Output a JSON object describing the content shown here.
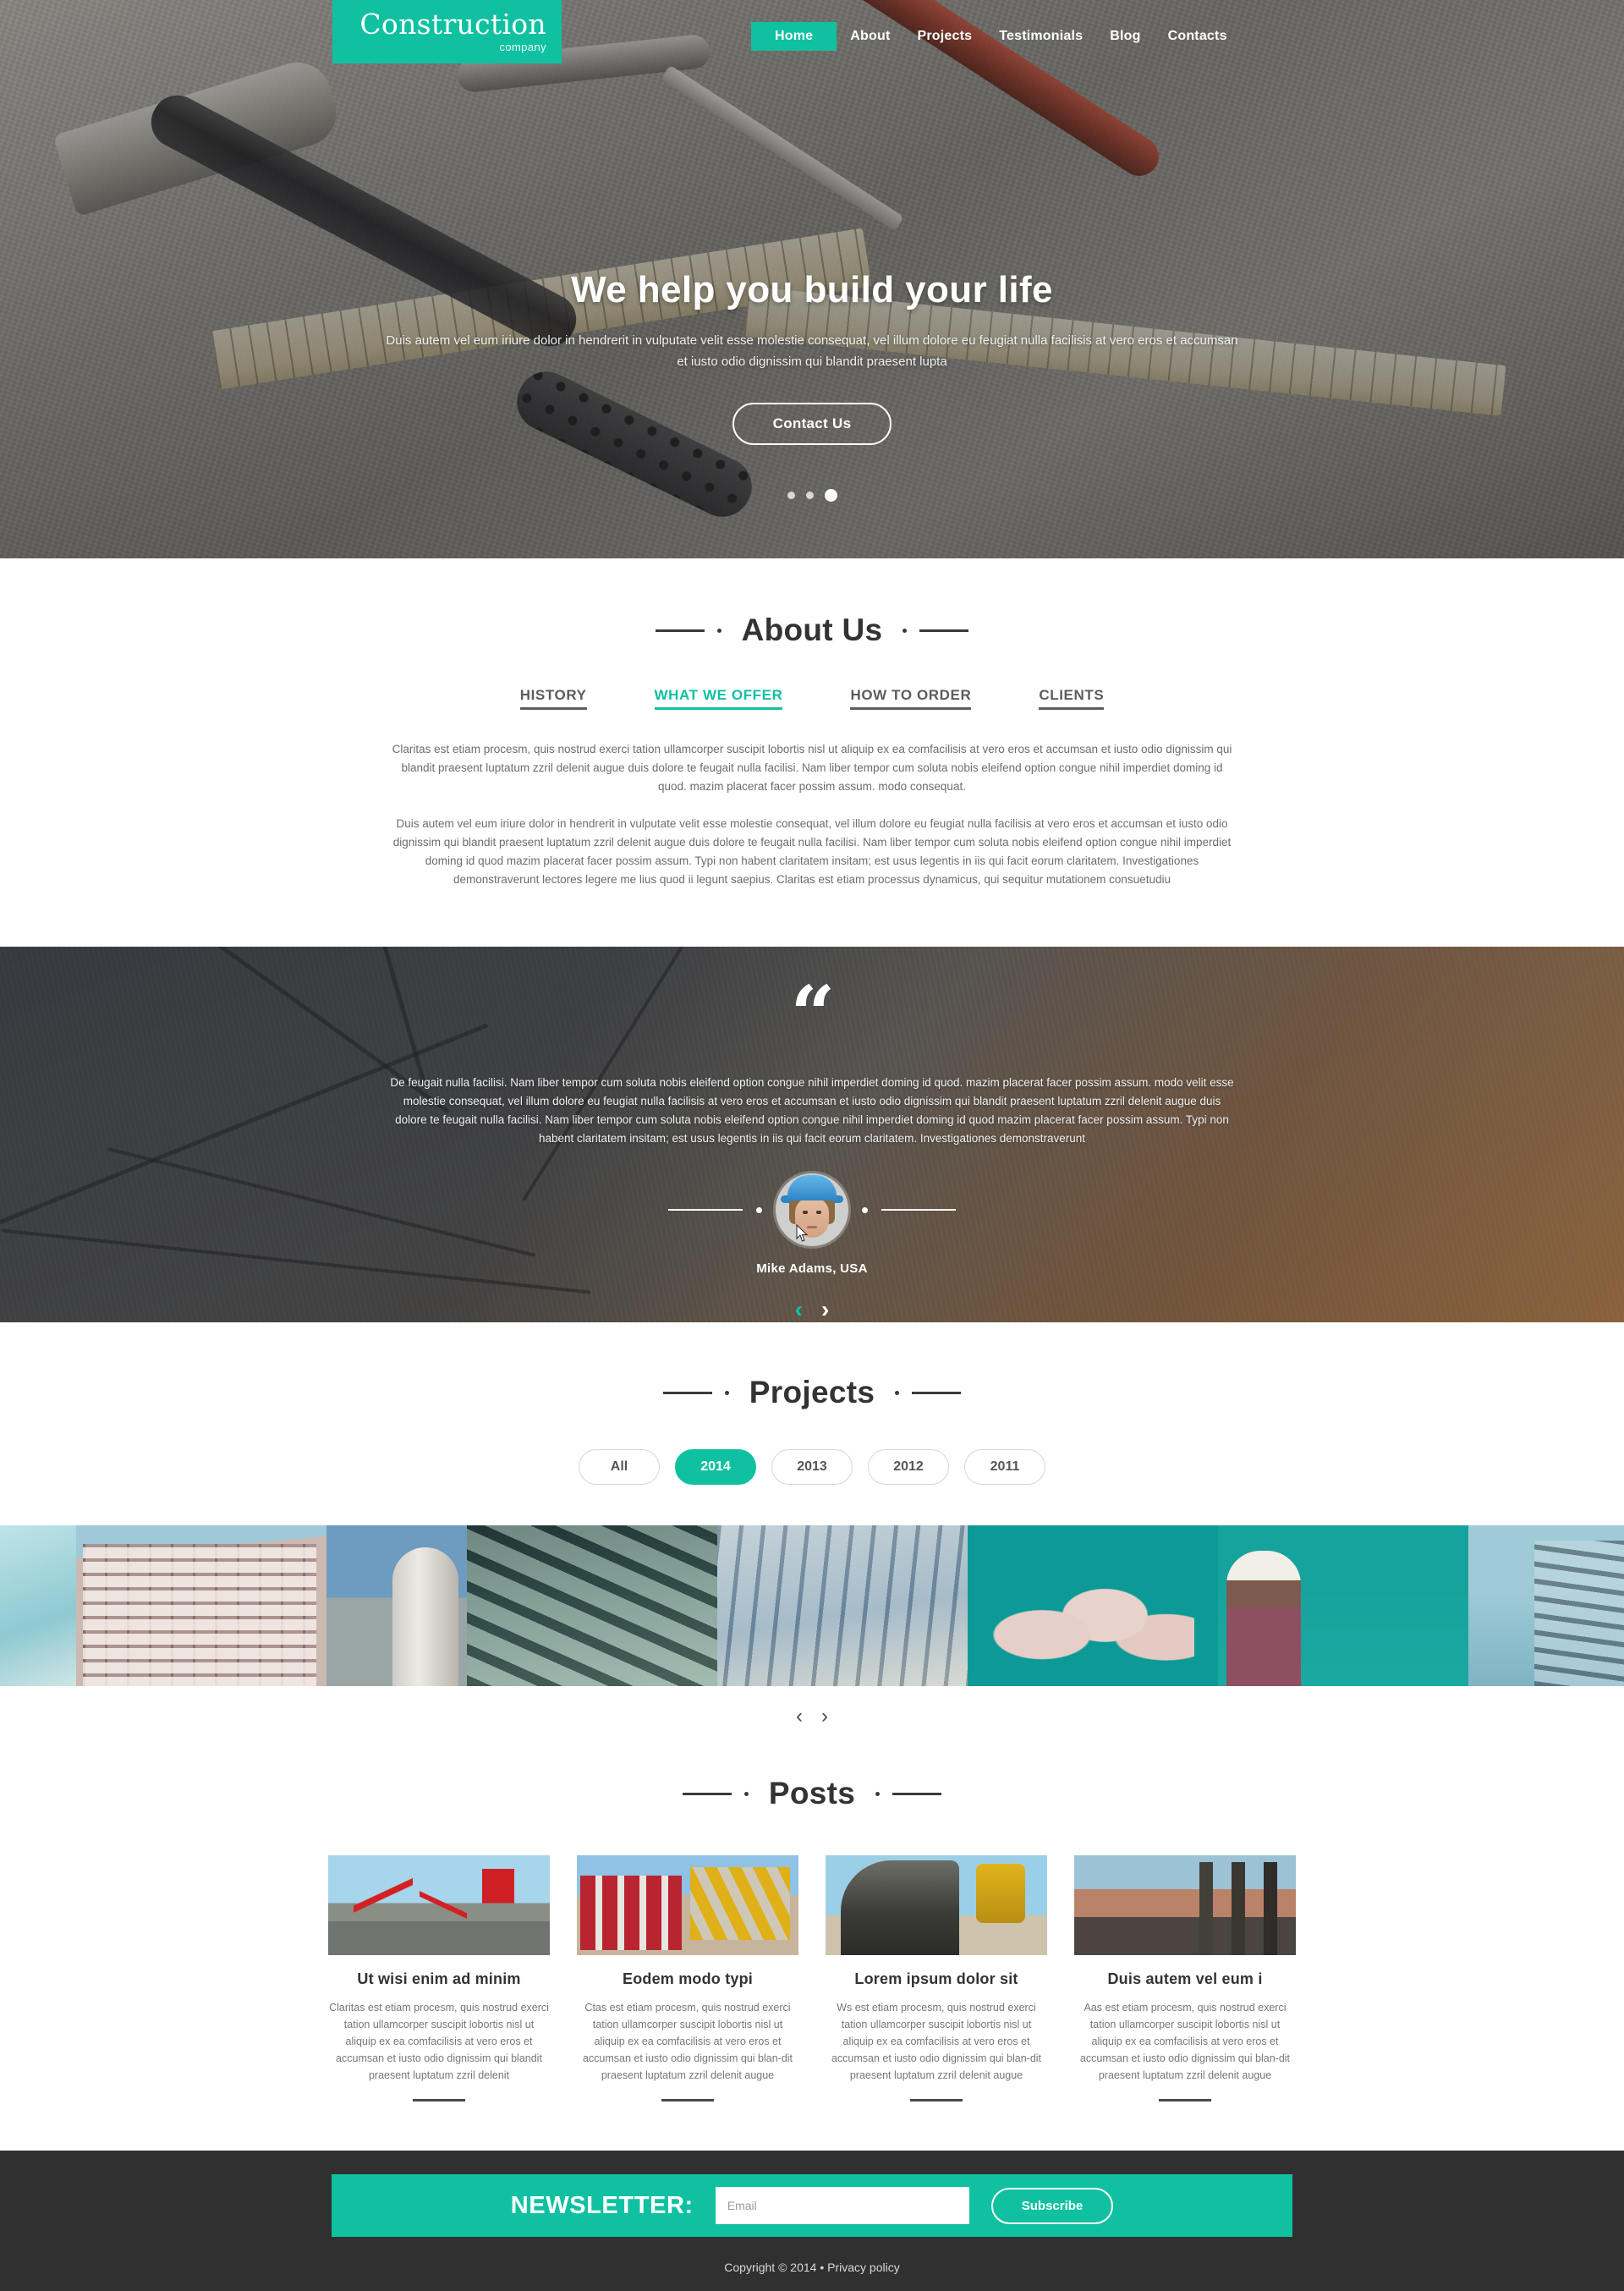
{
  "brand": {
    "name": "Construction",
    "tagline": "company",
    "accent": "#0fc1a1"
  },
  "nav": {
    "items": [
      {
        "label": "Home",
        "active": true
      },
      {
        "label": "About",
        "active": false
      },
      {
        "label": "Projects",
        "active": false
      },
      {
        "label": "Testimonials",
        "active": false
      },
      {
        "label": "Blog",
        "active": false
      },
      {
        "label": "Contacts",
        "active": false
      }
    ]
  },
  "hero": {
    "title": "We help you build your life",
    "subtitle": "Duis autem vel eum iriure dolor in hendrerit in vulputate velit esse molestie consequat, vel illum dolore eu feugiat nulla facilisis at vero eros et accumsan et iusto odio dignissim qui blandit praesent lupta",
    "cta_label": "Contact Us",
    "slides": 3,
    "active_slide": 3
  },
  "about": {
    "heading": "About Us",
    "tabs": [
      {
        "label": "HISTORY",
        "active": false
      },
      {
        "label": "WHAT WE OFFER",
        "active": true
      },
      {
        "label": "HOW TO ORDER",
        "active": false
      },
      {
        "label": "CLIENTS",
        "active": false
      }
    ],
    "paragraphs": [
      "Claritas est etiam procesm, quis nostrud exerci tation ullamcorper suscipit lobortis nisl ut aliquip ex ea comfacilisis at vero eros et accumsan et iusto odio dignissim qui blandit praesent luptatum zzril delenit augue duis dolore te feugait nulla facilisi. Nam liber tempor cum soluta nobis eleifend option congue nihil imperdiet doming id quod. mazim placerat facer possim assum. modo consequat.",
      "Duis autem vel eum iriure dolor in hendrerit in vulputate velit esse molestie consequat, vel illum dolore eu feugiat nulla facilisis at vero eros et accumsan et iusto odio dignissim qui blandit praesent luptatum zzril delenit augue duis dolore te feugait nulla facilisi. Nam liber tempor cum soluta nobis eleifend option congue nihil imperdiet doming id quod mazim placerat facer possim assum. Typi non habent claritatem insitam; est usus legentis in iis qui facit eorum claritatem. Investigationes demonstraverunt lectores legere me lius quod ii legunt saepius. Claritas est etiam processus dynamicus, qui sequitur mutationem consuetudiu"
    ]
  },
  "testimonial": {
    "quote_glyph": "“",
    "text": "De feugait nulla facilisi. Nam liber tempor cum soluta nobis eleifend option congue nihil imperdiet doming id quod. mazim placerat facer possim assum. modo velit esse molestie consequat, vel illum dolore eu feugiat nulla facilisis at vero eros et accumsan et iusto odio dignissim qui blandit praesent luptatum zzril delenit augue duis dolore te feugait nulla facilisi. Nam liber tempor cum soluta nobis eleifend option congue nihil imperdiet doming id quod mazim placerat facer possim assum. Typi non habent claritatem insitam; est usus legentis in iis qui facit eorum claritatem. Investigationes demonstraverunt",
    "author": "Mike Adams, USA",
    "prev_label": "‹",
    "next_label": "›"
  },
  "projects": {
    "heading": "Projects",
    "filters": [
      {
        "label": "All",
        "active": false
      },
      {
        "label": "2014",
        "active": true
      },
      {
        "label": "2013",
        "active": false
      },
      {
        "label": "2012",
        "active": false
      },
      {
        "label": "2011",
        "active": false
      }
    ],
    "items": [
      {
        "alt": "sky-edge-thumbnail"
      },
      {
        "alt": "high-rise-under-construction"
      },
      {
        "alt": "industrial-silo-tower"
      },
      {
        "alt": "dark-pipeline-facade"
      },
      {
        "alt": "glass-curtain-wall-building"
      },
      {
        "alt": "cement-silos-teal-sky"
      },
      {
        "alt": "worker-with-white-helmet"
      },
      {
        "alt": "scaffold-edge-thumbnail"
      }
    ],
    "prev_label": "‹",
    "next_label": "›"
  },
  "posts": {
    "heading": "Posts",
    "items": [
      {
        "thumb_alt": "road-work-signs",
        "title": "Ut wisi enim ad minim",
        "text": "Claritas est etiam procesm, quis nostrud exerci tation ullamcorper suscipit lobortis nisl ut aliquip ex ea comfacilisis at vero eros et accumsan et iusto odio dignissim qui blandit praesent luptatum zzril delenit"
      },
      {
        "thumb_alt": "red-trucks-and-excavators",
        "title": "Eodem modo typi",
        "text": "Ctas est etiam procesm, quis nostrud exerci tation ullamcorper suscipit lobortis nisl ut aliquip ex ea comfacilisis at vero eros et accumsan et iusto odio dignissim qui blan-dit praesent luptatum zzril delenit augue"
      },
      {
        "thumb_alt": "bucket-wheel-excavator",
        "title": "Lorem ipsum dolor sit",
        "text": "Ws est etiam procesm, quis nostrud exerci tation ullamcorper suscipit lobortis nisl ut aliquip ex ea comfacilisis at vero eros et accumsan et iusto odio dignissim qui blan-dit praesent luptatum zzril delenit augue"
      },
      {
        "thumb_alt": "conveyor-belt-at-mine",
        "title": "Duis autem vel eum i",
        "text": "Aas est etiam procesm, quis nostrud exerci tation ullamcorper suscipit lobortis nisl ut aliquip ex ea comfacilisis at vero eros et accumsan et iusto odio dignissim qui blan-dit praesent luptatum zzril delenit augue"
      }
    ]
  },
  "footer": {
    "newsletter_label": "NEWSLETTER:",
    "email_placeholder": "Email",
    "email_value": "",
    "subscribe_label": "Subscribe",
    "copyright": "Copyright © 2014 • Privacy policy"
  }
}
